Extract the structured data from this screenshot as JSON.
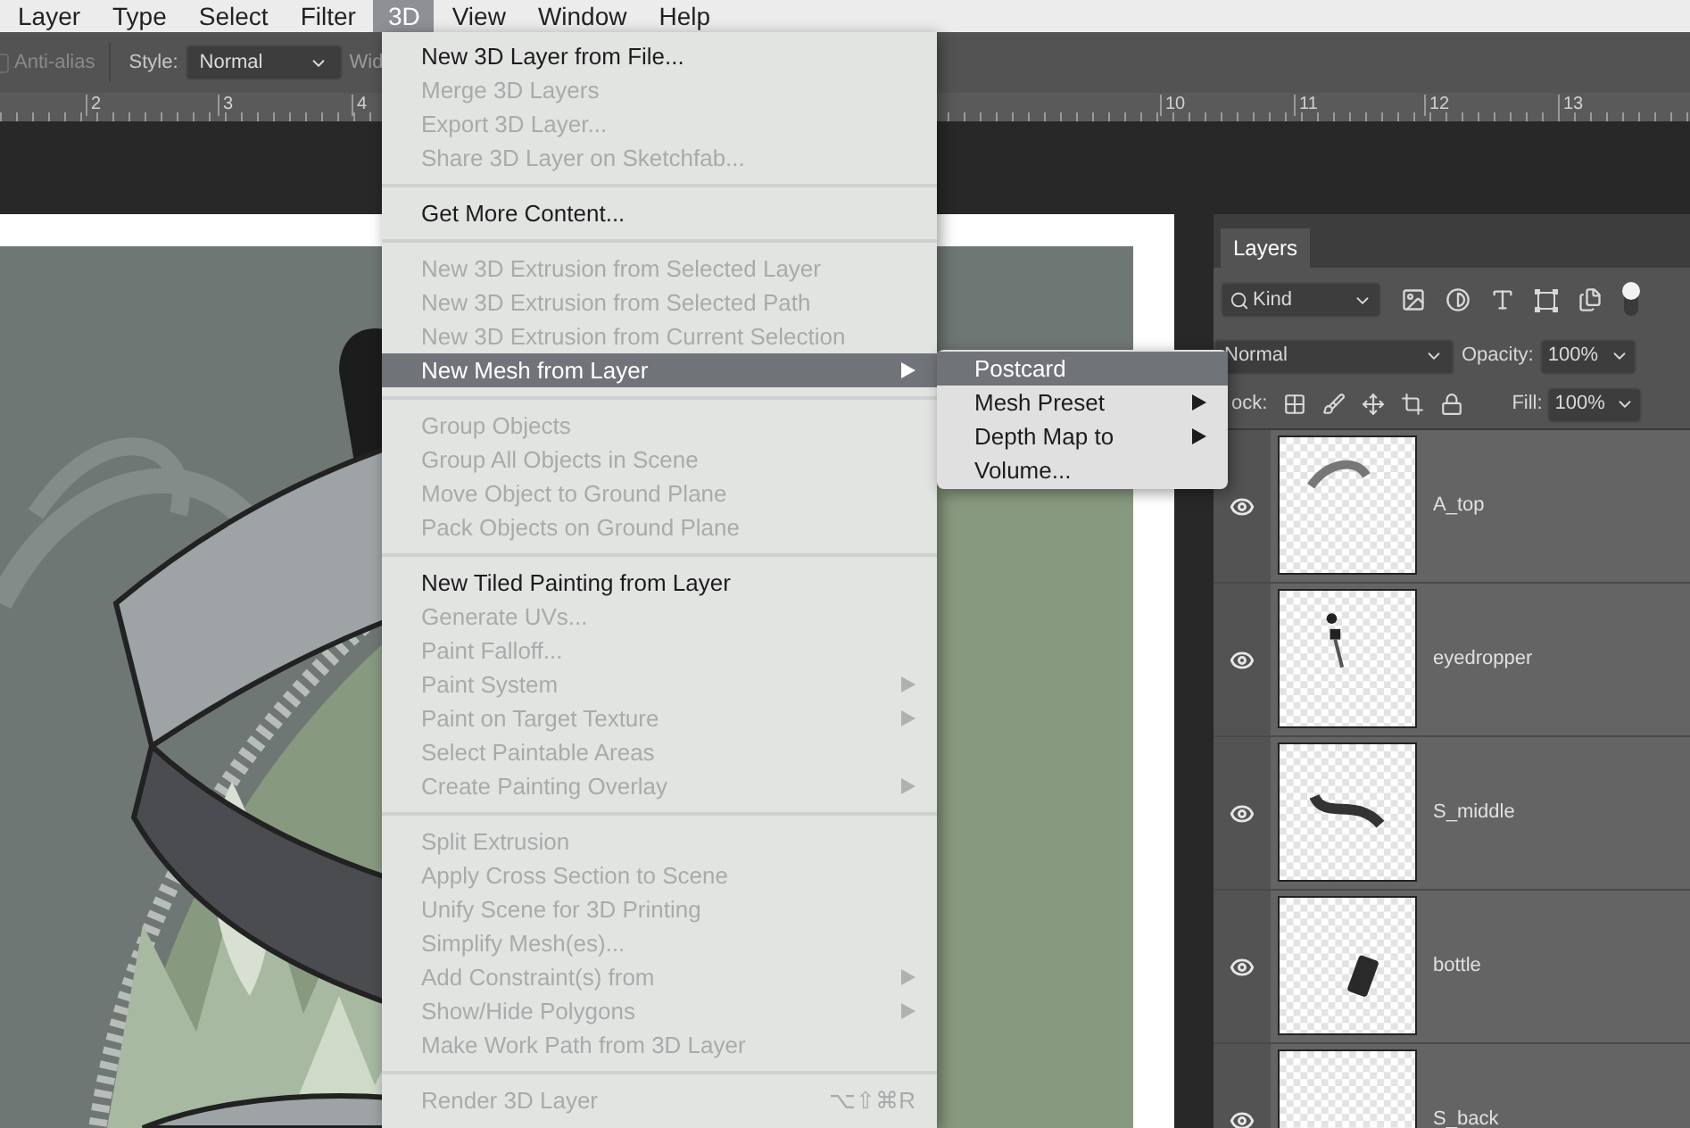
{
  "menu_bar": [
    {
      "label": "Layer",
      "selected": false
    },
    {
      "label": "Type",
      "selected": false
    },
    {
      "label": "Select",
      "selected": false
    },
    {
      "label": "Filter",
      "selected": false
    },
    {
      "label": "3D",
      "selected": true
    },
    {
      "label": "View",
      "selected": false
    },
    {
      "label": "Window",
      "selected": false
    },
    {
      "label": "Help",
      "selected": false
    }
  ],
  "options_bar": {
    "anti_alias": {
      "label": "Anti-alias",
      "checked": false,
      "disabled": true
    },
    "style_label": "Style:",
    "style_value": "Normal",
    "width_label": "Wid"
  },
  "ruler": {
    "labels": [
      "2",
      "3",
      "4",
      "10",
      "11",
      "12",
      "13"
    ]
  },
  "menu": {
    "items": [
      {
        "kind": "item",
        "label": "New 3D Layer from File...",
        "disabled": false,
        "submenu": false,
        "selected": false
      },
      {
        "kind": "item",
        "label": "Merge 3D Layers",
        "disabled": true,
        "submenu": false,
        "selected": false
      },
      {
        "kind": "item",
        "label": "Export 3D Layer...",
        "disabled": true,
        "submenu": false,
        "selected": false
      },
      {
        "kind": "item",
        "label": "Share 3D Layer on Sketchfab...",
        "disabled": true,
        "submenu": false,
        "selected": false
      },
      {
        "kind": "separator"
      },
      {
        "kind": "item",
        "label": "Get More Content...",
        "disabled": false,
        "submenu": false,
        "selected": false
      },
      {
        "kind": "separator"
      },
      {
        "kind": "item",
        "label": "New 3D Extrusion from Selected Layer",
        "disabled": true,
        "submenu": false,
        "selected": false
      },
      {
        "kind": "item",
        "label": "New 3D Extrusion from Selected Path",
        "disabled": true,
        "submenu": false,
        "selected": false
      },
      {
        "kind": "item",
        "label": "New 3D Extrusion from Current Selection",
        "disabled": true,
        "submenu": false,
        "selected": false
      },
      {
        "kind": "item",
        "label": "New Mesh from Layer",
        "disabled": false,
        "submenu": true,
        "selected": true
      },
      {
        "kind": "separator"
      },
      {
        "kind": "item",
        "label": "Group Objects",
        "disabled": true,
        "submenu": false,
        "selected": false
      },
      {
        "kind": "item",
        "label": "Group All Objects in Scene",
        "disabled": true,
        "submenu": false,
        "selected": false
      },
      {
        "kind": "item",
        "label": "Move Object to Ground Plane",
        "disabled": true,
        "submenu": false,
        "selected": false
      },
      {
        "kind": "item",
        "label": "Pack Objects on Ground Plane",
        "disabled": true,
        "submenu": false,
        "selected": false
      },
      {
        "kind": "separator"
      },
      {
        "kind": "item",
        "label": "New Tiled Painting from Layer",
        "disabled": false,
        "submenu": false,
        "selected": false
      },
      {
        "kind": "item",
        "label": "Generate UVs...",
        "disabled": true,
        "submenu": false,
        "selected": false
      },
      {
        "kind": "item",
        "label": "Paint Falloff...",
        "disabled": true,
        "submenu": false,
        "selected": false
      },
      {
        "kind": "item",
        "label": "Paint System",
        "disabled": true,
        "submenu": true,
        "selected": false
      },
      {
        "kind": "item",
        "label": "Paint on Target Texture",
        "disabled": true,
        "submenu": true,
        "selected": false
      },
      {
        "kind": "item",
        "label": "Select Paintable Areas",
        "disabled": true,
        "submenu": false,
        "selected": false
      },
      {
        "kind": "item",
        "label": "Create Painting Overlay",
        "disabled": true,
        "submenu": true,
        "selected": false
      },
      {
        "kind": "separator"
      },
      {
        "kind": "item",
        "label": "Split Extrusion",
        "disabled": true,
        "submenu": false,
        "selected": false
      },
      {
        "kind": "item",
        "label": "Apply Cross Section to Scene",
        "disabled": true,
        "submenu": false,
        "selected": false
      },
      {
        "kind": "item",
        "label": "Unify Scene for 3D Printing",
        "disabled": true,
        "submenu": false,
        "selected": false
      },
      {
        "kind": "item",
        "label": "Simplify Mesh(es)...",
        "disabled": true,
        "submenu": false,
        "selected": false
      },
      {
        "kind": "item",
        "label": "Add Constraint(s) from",
        "disabled": true,
        "submenu": true,
        "selected": false
      },
      {
        "kind": "item",
        "label": "Show/Hide Polygons",
        "disabled": true,
        "submenu": true,
        "selected": false
      },
      {
        "kind": "item",
        "label": "Make Work Path from 3D Layer",
        "disabled": true,
        "submenu": false,
        "selected": false
      },
      {
        "kind": "separator"
      },
      {
        "kind": "item",
        "label": "Render 3D Layer",
        "disabled": true,
        "submenu": false,
        "selected": false,
        "shortcut": "⌥⇧⌘R"
      }
    ]
  },
  "submenu": {
    "items": [
      {
        "label": "Postcard",
        "selected": true,
        "submenu": false
      },
      {
        "label": "Mesh Preset",
        "selected": false,
        "submenu": true
      },
      {
        "label": "Depth Map to",
        "selected": false,
        "submenu": true
      },
      {
        "label": "Volume...",
        "selected": false,
        "submenu": false
      }
    ]
  },
  "layers_panel": {
    "tab": "Layers",
    "filter_value": "Kind",
    "blend_mode": "Normal",
    "opacity_label": "Opacity:",
    "opacity_value": "100%",
    "lock_label": "ock:",
    "fill_label": "Fill:",
    "fill_value": "100%",
    "layers": [
      {
        "name": "A_top",
        "visible": true
      },
      {
        "name": "eyedropper",
        "visible": true
      },
      {
        "name": "S_middle",
        "visible": true
      },
      {
        "name": "bottle",
        "visible": true
      },
      {
        "name": "S_back",
        "visible": true
      }
    ]
  }
}
